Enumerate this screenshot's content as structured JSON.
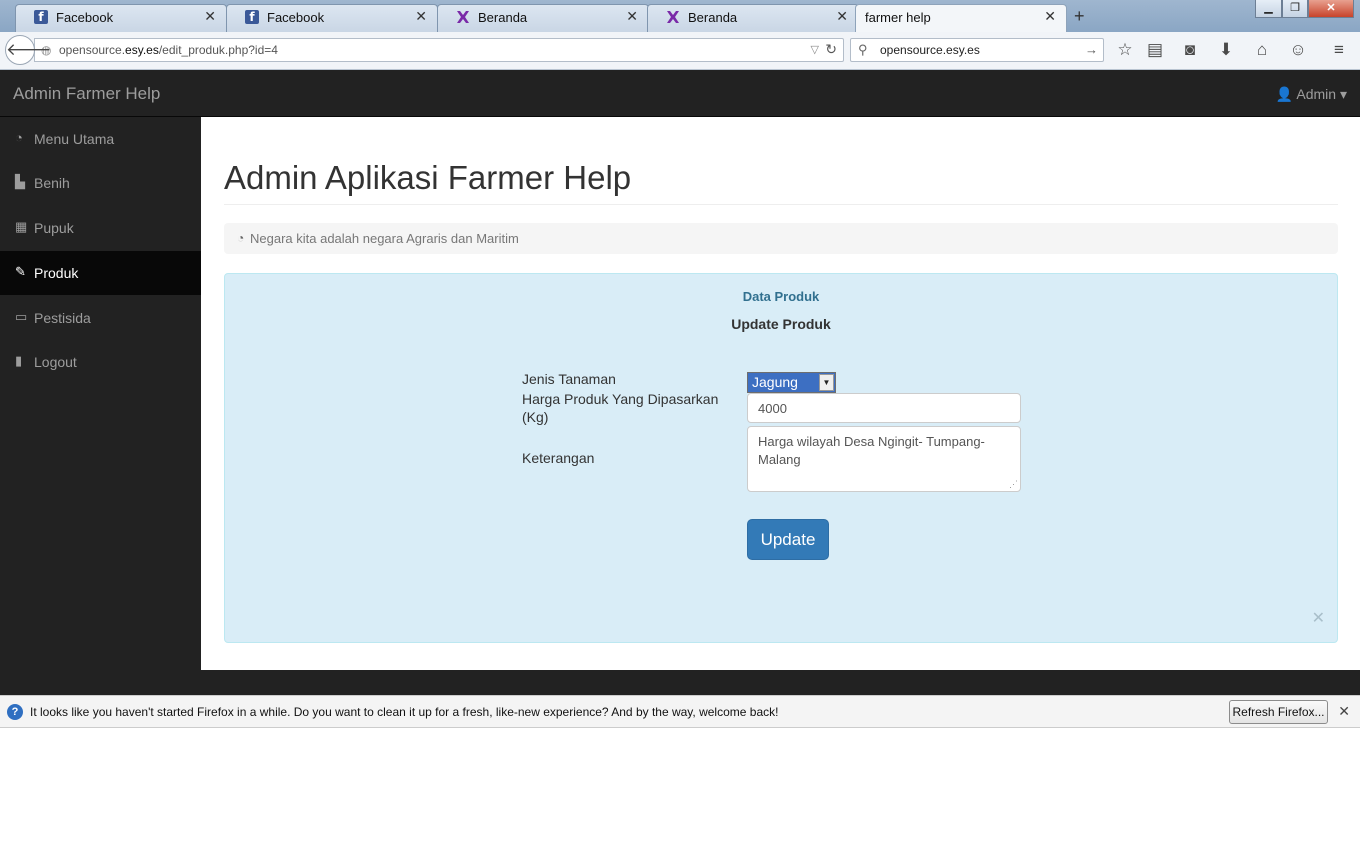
{
  "browser": {
    "tabs": [
      {
        "title": "Facebook",
        "icon": "facebook-icon"
      },
      {
        "title": "Facebook",
        "icon": "facebook-icon"
      },
      {
        "title": "Beranda",
        "icon": "site-favicon"
      },
      {
        "title": "Beranda",
        "icon": "site-favicon"
      },
      {
        "title": "farmer help",
        "icon": ""
      }
    ],
    "url_prefix": "opensource.",
    "url_domain": "esy.es",
    "url_path": "/edit_produk.php?id=4",
    "search_value": "opensource.esy.es"
  },
  "app": {
    "brand": "Admin Farmer Help",
    "user_menu": "Admin"
  },
  "sidebar": {
    "items": [
      {
        "label": "Menu Utama",
        "icon": "dashboard-icon"
      },
      {
        "label": "Benih",
        "icon": "bar-chart-icon"
      },
      {
        "label": "Pupuk",
        "icon": "table-icon"
      },
      {
        "label": "Produk",
        "icon": "edit-icon",
        "active": true
      },
      {
        "label": "Pestisida",
        "icon": "desktop-icon"
      },
      {
        "label": "Logout",
        "icon": "file-icon"
      }
    ]
  },
  "main": {
    "title": "Admin Aplikasi Farmer Help",
    "breadcrumb": "Negara kita adalah negara Agraris dan Maritim",
    "panel": {
      "title": "Data Produk",
      "subtitle": "Update Produk",
      "fields": {
        "jenis_label": "Jenis Tanaman",
        "jenis_value": "Jagung",
        "harga_label": "Harga Produk Yang Dipasarkan (Kg)",
        "harga_value": "4000",
        "ket_label": "Keterangan",
        "ket_value": "Harga wilayah Desa Ngingit- Tumpang-Malang"
      },
      "submit_label": "Update"
    }
  },
  "notification": {
    "text": "It looks like you haven't started Firefox in a while. Do you want to clean it up for a fresh, like-new experience? And by the way, welcome back!",
    "button_label": "Refresh Firefox..."
  },
  "colors": {
    "navbar_bg": "#222222",
    "active_sidebar": "#080808",
    "panel_bg": "#d9edf7",
    "panel_title": "#31708f",
    "button_primary": "#337ab7"
  }
}
